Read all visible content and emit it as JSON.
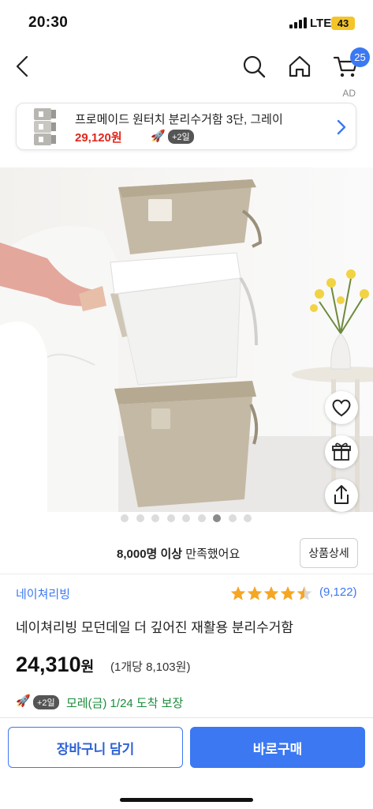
{
  "status": {
    "time": "20:30",
    "network": "LTE",
    "battery": "43"
  },
  "nav": {
    "cart_count": "25",
    "icons": [
      "back-icon",
      "search-icon",
      "home-icon",
      "cart-icon"
    ]
  },
  "ad": {
    "label": "AD",
    "title": "프로메이드 원터치 분리수거함 3단, 그레이",
    "price": "29,120원",
    "rocket": "🚀",
    "plus_badge": "+2일"
  },
  "gallery": {
    "total": 9,
    "active_index": 6
  },
  "fabs": [
    "heart-icon",
    "gift-icon",
    "share-icon"
  ],
  "satisfaction": {
    "count": "8,000명 이상",
    "text": " 만족했어요"
  },
  "detail_button": "상품상세",
  "product": {
    "brand": "네이쳐리빙",
    "rating": 4.5,
    "reviews": "(9,122)",
    "name": "네이쳐리빙 모던데일 더 깊어진 재활용 분리수거함",
    "price": "24,310",
    "price_unit": "원",
    "unit_price": "(1개당 8,103원)",
    "delivery_rocket": "🚀",
    "delivery_badge": "+2일",
    "delivery_text": "모레(금) 1/24 도착 보장"
  },
  "actions": {
    "cart": "장바구니 담기",
    "buy": "바로구매"
  },
  "colors": {
    "accent": "#3b78f2",
    "price_red": "#e0261b",
    "delivery_green": "#1a8d3a",
    "star": "#f5a623"
  }
}
